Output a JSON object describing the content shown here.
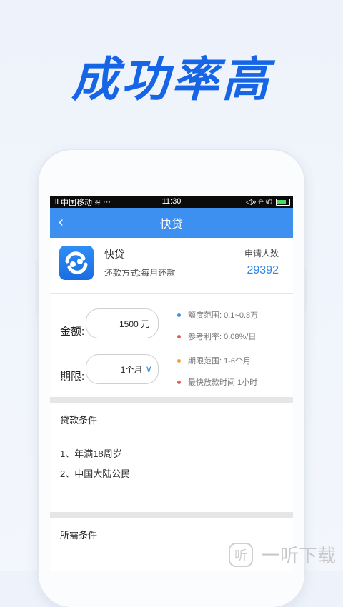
{
  "promo": {
    "headline": "成功率高"
  },
  "statusbar": {
    "carrier": "中国移动",
    "signal": "ıll",
    "extra": "···",
    "time": "11:30",
    "icons_right": "◁» ⍾ ✆"
  },
  "appbar": {
    "back": "‹",
    "title": "快贷"
  },
  "product": {
    "name": "快贷",
    "repay": "还款方式:每月还款",
    "apply_label": "申请人数",
    "apply_count": "29392",
    "logo_color": "#2f8ef5"
  },
  "calculator": {
    "amount_label": "金额:",
    "amount_value": "1500 元",
    "term_label": "期限:",
    "term_value": "1个月",
    "chevron": "∨",
    "info": [
      {
        "text": "额度范围: 0.1~0.8万",
        "color": "#3f8fe6"
      },
      {
        "text": "参考利率: 0.08%/日",
        "color": "#e0604a"
      },
      {
        "text": "期限范围: 1-6个月",
        "color": "#f0a12b"
      },
      {
        "text": "最快放款时间 1小时",
        "color": "#e0604a"
      }
    ]
  },
  "conditions": {
    "title": "贷款条件",
    "items": [
      "1、年满18周岁",
      "2、中国大陆公民"
    ]
  },
  "requirements": {
    "title": "所需条件"
  },
  "watermark": {
    "icon_text": "听",
    "text": "一听下载"
  }
}
